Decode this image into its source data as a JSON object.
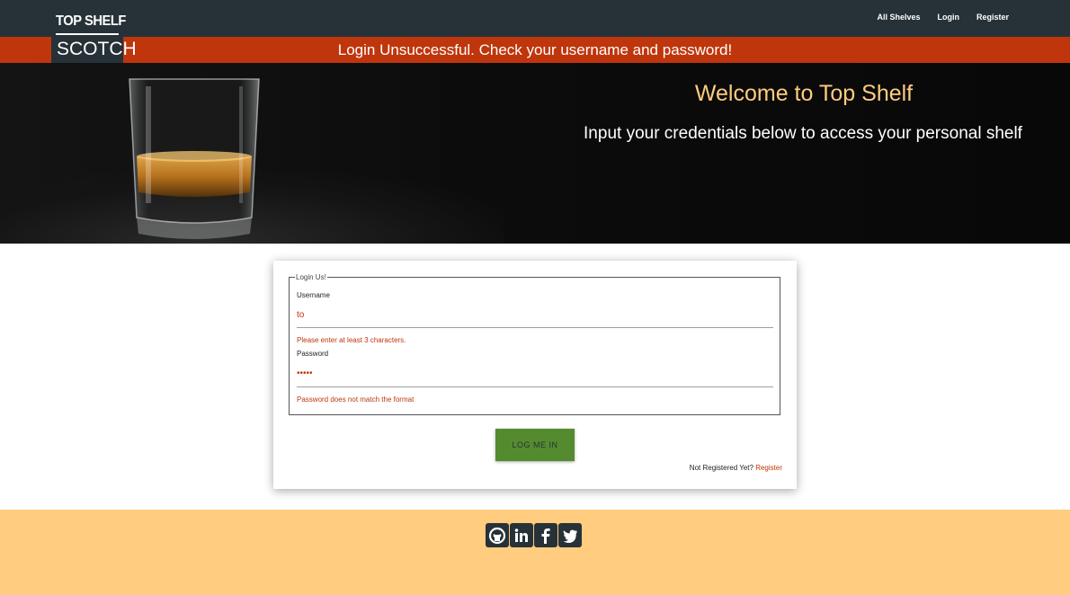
{
  "brand": {
    "top": "TOP SHELF",
    "bottom": "SCOTCH"
  },
  "nav": {
    "items": [
      "All Shelves",
      "Login",
      "Register"
    ]
  },
  "alert": {
    "message": "Login Unsuccessful. Check your username and password!"
  },
  "hero": {
    "title": "Welcome to Top Shelf",
    "subtitle": "Input your credentials below to access your personal shelf"
  },
  "form": {
    "legend": "Login Us!",
    "username_label": "Username",
    "username_value": "to",
    "username_error": "Please enter at least 3 characters.",
    "password_label": "Password",
    "password_value": "•••••",
    "password_error": "Password does not match the format",
    "submit_label": "LOG ME IN",
    "register_prompt": "Not Registered Yet?",
    "register_link": "Register"
  },
  "footer": {
    "icons": [
      "github-icon",
      "linkedin-icon",
      "facebook-icon",
      "twitter-icon"
    ]
  },
  "colors": {
    "nav": "#263238",
    "alert": "#bf360c",
    "accent": "#ffcc80",
    "button": "#558b2f"
  }
}
